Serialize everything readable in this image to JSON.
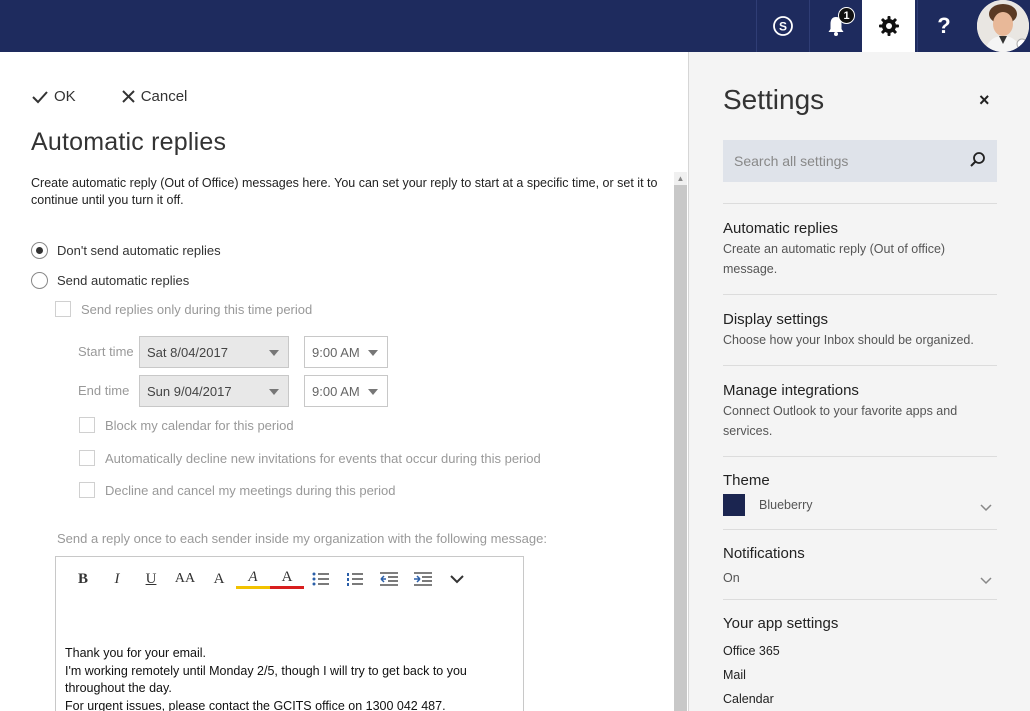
{
  "topbar": {
    "skype_icon": "skype-icon",
    "bell_icon": "bell-icon",
    "notification_count": "1",
    "gear_icon": "gear-icon",
    "help_label": "?",
    "avatar_icon": "user-avatar"
  },
  "actions": {
    "ok_label": "OK",
    "cancel_label": "Cancel"
  },
  "page": {
    "title": "Automatic replies",
    "description": "Create automatic reply (Out of Office) messages here. You can set your reply to start at a specific time, or set it to continue until you turn it off."
  },
  "options": {
    "dont_send": "Don't send automatic replies",
    "send": "Send automatic replies",
    "time_period": "Send replies only during this time period",
    "start_label": "Start time",
    "start_date": "Sat 8/04/2017",
    "start_time": "9:00 AM",
    "end_label": "End time",
    "end_date": "Sun 9/04/2017",
    "end_time": "9:00 AM",
    "block_calendar": "Block my calendar for this period",
    "decline_invitations": "Automatically decline new invitations for events that occur during this period",
    "decline_meetings": "Decline and cancel my meetings during this period"
  },
  "message": {
    "label": "Send a reply once to each sender inside my organization with the following message:",
    "toolbar": [
      "B",
      "I",
      "U",
      "AA",
      "A",
      "A",
      "A"
    ],
    "lines": [
      "Thank you for your email.",
      "I'm working remotely until Monday 2/5, though I will try to get back to you throughout the day.",
      "For urgent issues, please contact the GCITS office on 1300 042 487."
    ]
  },
  "settings": {
    "title": "Settings",
    "close": "×",
    "search_placeholder": "Search all settings",
    "sections": {
      "auto_title": "Automatic replies",
      "auto_desc": "Create an automatic reply (Out of office) message.",
      "display_title": "Display settings",
      "display_desc": "Choose how your Inbox should be organized.",
      "integrations_title": "Manage integrations",
      "integrations_desc": "Connect Outlook to your favorite apps and services.",
      "theme_title": "Theme",
      "theme_value": "Blueberry",
      "theme_color": "#1b2550",
      "notifications_title": "Notifications",
      "notifications_value": "On",
      "app_title": "Your app settings",
      "apps": [
        "Office 365",
        "Mail",
        "Calendar"
      ]
    }
  },
  "colors": {
    "topbar": "#1e2b5e",
    "settings_bg": "#f4f4f4"
  }
}
